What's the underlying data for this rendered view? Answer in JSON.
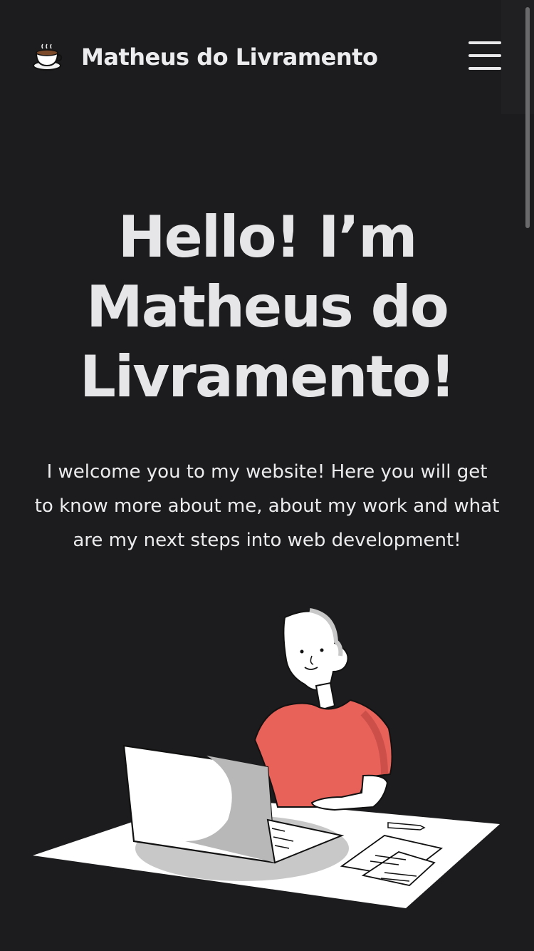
{
  "header": {
    "logo_icon": "coffee-cup-icon",
    "brand_name": "Matheus do Livramento",
    "menu_icon": "hamburger-menu-icon"
  },
  "hero": {
    "title_line1": "Hello! I’m",
    "title_line2": "Matheus do",
    "title_line3": "Livramento!",
    "intro_line1": "I welcome you to my website! Here you will get",
    "intro_line2": "to know more about me, about my work and what",
    "intro_line3": "are my next steps into web development!"
  },
  "colors": {
    "background": "#1c1c1e",
    "text": "#e8e8ea",
    "shirt": "#e8625a"
  },
  "illustration": {
    "icon": "person-at-laptop-illustration"
  }
}
